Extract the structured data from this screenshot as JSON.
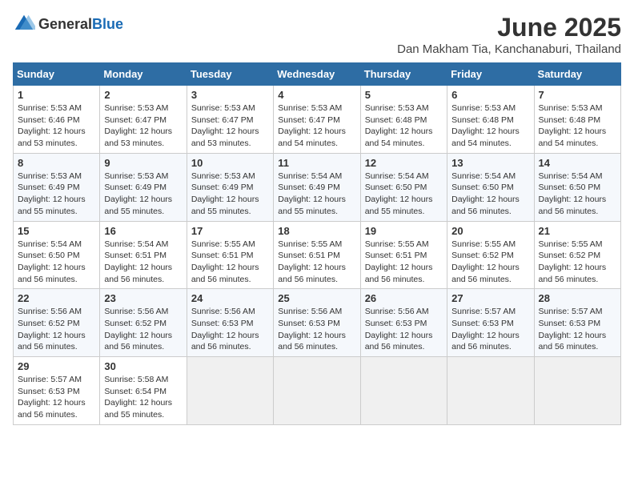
{
  "logo": {
    "general": "General",
    "blue": "Blue"
  },
  "title": "June 2025",
  "subtitle": "Dan Makham Tia, Kanchanaburi, Thailand",
  "weekdays": [
    "Sunday",
    "Monday",
    "Tuesday",
    "Wednesday",
    "Thursday",
    "Friday",
    "Saturday"
  ],
  "weeks": [
    [
      {
        "day": "1",
        "sunrise": "5:53 AM",
        "sunset": "6:46 PM",
        "daylight": "12 hours and 53 minutes."
      },
      {
        "day": "2",
        "sunrise": "5:53 AM",
        "sunset": "6:47 PM",
        "daylight": "12 hours and 53 minutes."
      },
      {
        "day": "3",
        "sunrise": "5:53 AM",
        "sunset": "6:47 PM",
        "daylight": "12 hours and 53 minutes."
      },
      {
        "day": "4",
        "sunrise": "5:53 AM",
        "sunset": "6:47 PM",
        "daylight": "12 hours and 54 minutes."
      },
      {
        "day": "5",
        "sunrise": "5:53 AM",
        "sunset": "6:48 PM",
        "daylight": "12 hours and 54 minutes."
      },
      {
        "day": "6",
        "sunrise": "5:53 AM",
        "sunset": "6:48 PM",
        "daylight": "12 hours and 54 minutes."
      },
      {
        "day": "7",
        "sunrise": "5:53 AM",
        "sunset": "6:48 PM",
        "daylight": "12 hours and 54 minutes."
      }
    ],
    [
      {
        "day": "8",
        "sunrise": "5:53 AM",
        "sunset": "6:49 PM",
        "daylight": "12 hours and 55 minutes."
      },
      {
        "day": "9",
        "sunrise": "5:53 AM",
        "sunset": "6:49 PM",
        "daylight": "12 hours and 55 minutes."
      },
      {
        "day": "10",
        "sunrise": "5:53 AM",
        "sunset": "6:49 PM",
        "daylight": "12 hours and 55 minutes."
      },
      {
        "day": "11",
        "sunrise": "5:54 AM",
        "sunset": "6:49 PM",
        "daylight": "12 hours and 55 minutes."
      },
      {
        "day": "12",
        "sunrise": "5:54 AM",
        "sunset": "6:50 PM",
        "daylight": "12 hours and 55 minutes."
      },
      {
        "day": "13",
        "sunrise": "5:54 AM",
        "sunset": "6:50 PM",
        "daylight": "12 hours and 56 minutes."
      },
      {
        "day": "14",
        "sunrise": "5:54 AM",
        "sunset": "6:50 PM",
        "daylight": "12 hours and 56 minutes."
      }
    ],
    [
      {
        "day": "15",
        "sunrise": "5:54 AM",
        "sunset": "6:50 PM",
        "daylight": "12 hours and 56 minutes."
      },
      {
        "day": "16",
        "sunrise": "5:54 AM",
        "sunset": "6:51 PM",
        "daylight": "12 hours and 56 minutes."
      },
      {
        "day": "17",
        "sunrise": "5:55 AM",
        "sunset": "6:51 PM",
        "daylight": "12 hours and 56 minutes."
      },
      {
        "day": "18",
        "sunrise": "5:55 AM",
        "sunset": "6:51 PM",
        "daylight": "12 hours and 56 minutes."
      },
      {
        "day": "19",
        "sunrise": "5:55 AM",
        "sunset": "6:51 PM",
        "daylight": "12 hours and 56 minutes."
      },
      {
        "day": "20",
        "sunrise": "5:55 AM",
        "sunset": "6:52 PM",
        "daylight": "12 hours and 56 minutes."
      },
      {
        "day": "21",
        "sunrise": "5:55 AM",
        "sunset": "6:52 PM",
        "daylight": "12 hours and 56 minutes."
      }
    ],
    [
      {
        "day": "22",
        "sunrise": "5:56 AM",
        "sunset": "6:52 PM",
        "daylight": "12 hours and 56 minutes."
      },
      {
        "day": "23",
        "sunrise": "5:56 AM",
        "sunset": "6:52 PM",
        "daylight": "12 hours and 56 minutes."
      },
      {
        "day": "24",
        "sunrise": "5:56 AM",
        "sunset": "6:53 PM",
        "daylight": "12 hours and 56 minutes."
      },
      {
        "day": "25",
        "sunrise": "5:56 AM",
        "sunset": "6:53 PM",
        "daylight": "12 hours and 56 minutes."
      },
      {
        "day": "26",
        "sunrise": "5:56 AM",
        "sunset": "6:53 PM",
        "daylight": "12 hours and 56 minutes."
      },
      {
        "day": "27",
        "sunrise": "5:57 AM",
        "sunset": "6:53 PM",
        "daylight": "12 hours and 56 minutes."
      },
      {
        "day": "28",
        "sunrise": "5:57 AM",
        "sunset": "6:53 PM",
        "daylight": "12 hours and 56 minutes."
      }
    ],
    [
      {
        "day": "29",
        "sunrise": "5:57 AM",
        "sunset": "6:53 PM",
        "daylight": "12 hours and 56 minutes."
      },
      {
        "day": "30",
        "sunrise": "5:58 AM",
        "sunset": "6:54 PM",
        "daylight": "12 hours and 55 minutes."
      },
      null,
      null,
      null,
      null,
      null
    ]
  ]
}
